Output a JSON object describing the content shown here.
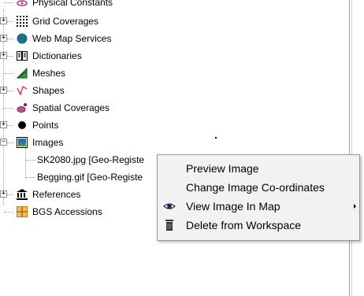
{
  "tree": {
    "items": [
      {
        "label": "Physical Constants",
        "icon": "physical-constants-icon",
        "expander": ""
      },
      {
        "label": "Grid Coverages",
        "icon": "grid-coverages-icon",
        "expander": "+"
      },
      {
        "label": "Web Map Services",
        "icon": "globe-icon",
        "expander": "+"
      },
      {
        "label": "Dictionaries",
        "icon": "dictionary-icon",
        "expander": "+"
      },
      {
        "label": "Meshes",
        "icon": "mesh-icon",
        "expander": ""
      },
      {
        "label": "Shapes",
        "icon": "shapes-icon",
        "expander": "+"
      },
      {
        "label": "Spatial Coverages",
        "icon": "spatial-coverages-icon",
        "expander": ""
      },
      {
        "label": "Points",
        "icon": "point-icon",
        "expander": "+"
      },
      {
        "label": "Images",
        "icon": "images-icon",
        "expander": "−"
      },
      {
        "label": "SK2080.jpg [Geo-Registe",
        "icon": "",
        "expander": ""
      },
      {
        "label": "Begging.gif [Geo-Registe",
        "icon": "",
        "expander": ""
      },
      {
        "label": "References",
        "icon": "references-icon",
        "expander": "+"
      },
      {
        "label": "BGS Accessions",
        "icon": "bgs-accessions-icon",
        "expander": ""
      }
    ]
  },
  "context_menu": {
    "items": [
      {
        "label": "Preview Image",
        "icon": "",
        "submenu": false
      },
      {
        "label": "Change Image Co-ordinates",
        "icon": "",
        "submenu": false
      },
      {
        "label": "View Image In Map",
        "icon": "eye-icon",
        "submenu": true
      },
      {
        "label": "Delete from Workspace",
        "icon": "trash-icon",
        "submenu": false
      }
    ]
  },
  "colors": {
    "menu_background": "#f2f2f2",
    "menu_border": "#979797",
    "globe": "#1a8a2e",
    "mesh": "#2e9e3a",
    "shape": "#d04060",
    "spatial": "#c05090",
    "accession": "#c07a1a"
  }
}
